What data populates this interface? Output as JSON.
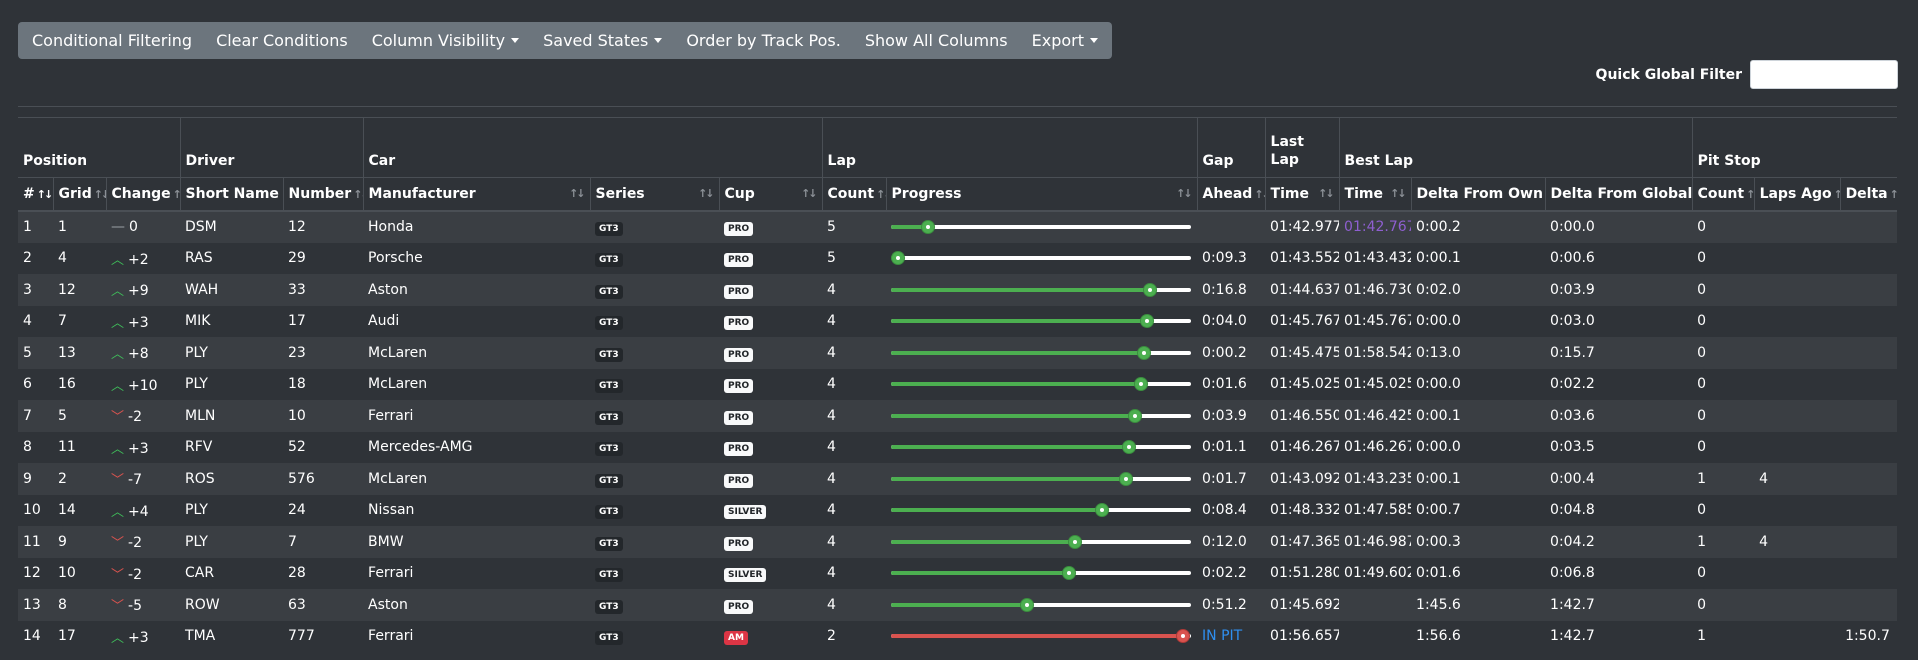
{
  "toolbar": {
    "buttons": [
      {
        "label": "Conditional Filtering",
        "dropdown": false
      },
      {
        "label": "Clear Conditions",
        "dropdown": false
      },
      {
        "label": "Column Visibility",
        "dropdown": true
      },
      {
        "label": "Saved States",
        "dropdown": true
      },
      {
        "label": "Order by Track Pos.",
        "dropdown": false
      },
      {
        "label": "Show All Columns",
        "dropdown": false
      },
      {
        "label": "Export",
        "dropdown": true
      }
    ]
  },
  "filter": {
    "label": "Quick Global Filter",
    "value": ""
  },
  "column_groups": [
    "Position",
    "Driver",
    "Car",
    "Lap",
    "Gap",
    "Last Lap",
    "Best Lap",
    "Pit Stop"
  ],
  "columns": [
    "#",
    "Grid",
    "Change",
    "Short Name",
    "Number",
    "Manufacturer",
    "Series",
    "Cup",
    "Count",
    "Progress",
    "Ahead",
    "Time",
    "Time",
    "Delta From Own",
    "Delta From Global",
    "Count",
    "Laps Ago",
    "Delta"
  ],
  "colors": {
    "up": "#3fbf5a",
    "down": "#d9534f",
    "best_lap_purple": "#8e5fd0",
    "in_pit": "#2f8ff0",
    "progress_green": "#4caf50",
    "progress_red": "#d9534f"
  },
  "rows": [
    {
      "pos": "1",
      "grid": "1",
      "dir": "none",
      "change": "0",
      "name": "DSM",
      "number": "12",
      "manufacturer": "Honda",
      "series": "GT3",
      "cup": "PRO",
      "count": "5",
      "progress": 0.12,
      "ahead": "",
      "last": "01:42.977",
      "best": "01:42.767",
      "best_purple": true,
      "d_own": "0:00.2",
      "d_global": "0:00.0",
      "pit_count": "0",
      "pit_ago": "",
      "pit_delta": ""
    },
    {
      "pos": "2",
      "grid": "4",
      "dir": "up",
      "change": "+2",
      "name": "RAS",
      "number": "29",
      "manufacturer": "Porsche",
      "series": "GT3",
      "cup": "PRO",
      "count": "5",
      "progress": 0.02,
      "ahead": "0:09.3",
      "last": "01:43.552",
      "best": "01:43.432",
      "best_purple": false,
      "d_own": "0:00.1",
      "d_global": "0:00.6",
      "pit_count": "0",
      "pit_ago": "",
      "pit_delta": ""
    },
    {
      "pos": "3",
      "grid": "12",
      "dir": "up",
      "change": "+9",
      "name": "WAH",
      "number": "33",
      "manufacturer": "Aston",
      "series": "GT3",
      "cup": "PRO",
      "count": "4",
      "progress": 0.86,
      "ahead": "0:16.8",
      "last": "01:44.637",
      "best": "01:46.730",
      "best_purple": false,
      "d_own": "0:02.0",
      "d_global": "0:03.9",
      "pit_count": "0",
      "pit_ago": "",
      "pit_delta": ""
    },
    {
      "pos": "4",
      "grid": "7",
      "dir": "up",
      "change": "+3",
      "name": "MIK",
      "number": "17",
      "manufacturer": "Audi",
      "series": "GT3",
      "cup": "PRO",
      "count": "4",
      "progress": 0.85,
      "ahead": "0:04.0",
      "last": "01:45.767",
      "best": "01:45.767",
      "best_purple": false,
      "d_own": "0:00.0",
      "d_global": "0:03.0",
      "pit_count": "0",
      "pit_ago": "",
      "pit_delta": ""
    },
    {
      "pos": "5",
      "grid": "13",
      "dir": "up",
      "change": "+8",
      "name": "PLY",
      "number": "23",
      "manufacturer": "McLaren",
      "series": "GT3",
      "cup": "PRO",
      "count": "4",
      "progress": 0.84,
      "ahead": "0:00.2",
      "last": "01:45.475",
      "best": "01:58.542",
      "best_purple": false,
      "d_own": "0:13.0",
      "d_global": "0:15.7",
      "pit_count": "0",
      "pit_ago": "",
      "pit_delta": ""
    },
    {
      "pos": "6",
      "grid": "16",
      "dir": "up",
      "change": "+10",
      "name": "PLY",
      "number": "18",
      "manufacturer": "McLaren",
      "series": "GT3",
      "cup": "PRO",
      "count": "4",
      "progress": 0.83,
      "ahead": "0:01.6",
      "last": "01:45.025",
      "best": "01:45.025",
      "best_purple": false,
      "d_own": "0:00.0",
      "d_global": "0:02.2",
      "pit_count": "0",
      "pit_ago": "",
      "pit_delta": ""
    },
    {
      "pos": "7",
      "grid": "5",
      "dir": "down",
      "change": "-2",
      "name": "MLN",
      "number": "10",
      "manufacturer": "Ferrari",
      "series": "GT3",
      "cup": "PRO",
      "count": "4",
      "progress": 0.81,
      "ahead": "0:03.9",
      "last": "01:46.550",
      "best": "01:46.425",
      "best_purple": false,
      "d_own": "0:00.1",
      "d_global": "0:03.6",
      "pit_count": "0",
      "pit_ago": "",
      "pit_delta": ""
    },
    {
      "pos": "8",
      "grid": "11",
      "dir": "up",
      "change": "+3",
      "name": "RFV",
      "number": "52",
      "manufacturer": "Mercedes-AMG",
      "series": "GT3",
      "cup": "PRO",
      "count": "4",
      "progress": 0.79,
      "ahead": "0:01.1",
      "last": "01:46.267",
      "best": "01:46.267",
      "best_purple": false,
      "d_own": "0:00.0",
      "d_global": "0:03.5",
      "pit_count": "0",
      "pit_ago": "",
      "pit_delta": ""
    },
    {
      "pos": "9",
      "grid": "2",
      "dir": "down",
      "change": "-7",
      "name": "ROS",
      "number": "576",
      "manufacturer": "McLaren",
      "series": "GT3",
      "cup": "PRO",
      "count": "4",
      "progress": 0.78,
      "ahead": "0:01.7",
      "last": "01:43.092",
      "best": "01:43.235",
      "best_purple": false,
      "d_own": "0:00.1",
      "d_global": "0:00.4",
      "pit_count": "1",
      "pit_ago": "4",
      "pit_delta": ""
    },
    {
      "pos": "10",
      "grid": "14",
      "dir": "up",
      "change": "+4",
      "name": "PLY",
      "number": "24",
      "manufacturer": "Nissan",
      "series": "GT3",
      "cup": "SILVER",
      "count": "4",
      "progress": 0.7,
      "ahead": "0:08.4",
      "last": "01:48.332",
      "best": "01:47.585",
      "best_purple": false,
      "d_own": "0:00.7",
      "d_global": "0:04.8",
      "pit_count": "0",
      "pit_ago": "",
      "pit_delta": ""
    },
    {
      "pos": "11",
      "grid": "9",
      "dir": "down",
      "change": "-2",
      "name": "PLY",
      "number": "7",
      "manufacturer": "BMW",
      "series": "GT3",
      "cup": "PRO",
      "count": "4",
      "progress": 0.61,
      "ahead": "0:12.0",
      "last": "01:47.365",
      "best": "01:46.987",
      "best_purple": false,
      "d_own": "0:00.3",
      "d_global": "0:04.2",
      "pit_count": "1",
      "pit_ago": "4",
      "pit_delta": ""
    },
    {
      "pos": "12",
      "grid": "10",
      "dir": "down",
      "change": "-2",
      "name": "CAR",
      "number": "28",
      "manufacturer": "Ferrari",
      "series": "GT3",
      "cup": "SILVER",
      "count": "4",
      "progress": 0.59,
      "ahead": "0:02.2",
      "last": "01:51.280",
      "best": "01:49.602",
      "best_purple": false,
      "d_own": "0:01.6",
      "d_global": "0:06.8",
      "pit_count": "0",
      "pit_ago": "",
      "pit_delta": ""
    },
    {
      "pos": "13",
      "grid": "8",
      "dir": "down",
      "change": "-5",
      "name": "ROW",
      "number": "63",
      "manufacturer": "Aston",
      "series": "GT3",
      "cup": "PRO",
      "count": "4",
      "progress": 0.45,
      "ahead": "0:51.2",
      "last": "01:45.692",
      "best": "",
      "best_purple": false,
      "d_own": "1:45.6",
      "d_global": "1:42.7",
      "pit_count": "0",
      "pit_ago": "",
      "pit_delta": ""
    },
    {
      "pos": "14",
      "grid": "17",
      "dir": "up",
      "change": "+3",
      "name": "TMA",
      "number": "777",
      "manufacturer": "Ferrari",
      "series": "GT3",
      "cup": "AM",
      "count": "2",
      "progress": 0.97,
      "pit": true,
      "ahead": "IN PIT",
      "last": "01:56.657",
      "best": "",
      "best_purple": false,
      "d_own": "1:56.6",
      "d_global": "1:42.7",
      "pit_count": "1",
      "pit_ago": "",
      "pit_delta": "1:50.7"
    }
  ]
}
